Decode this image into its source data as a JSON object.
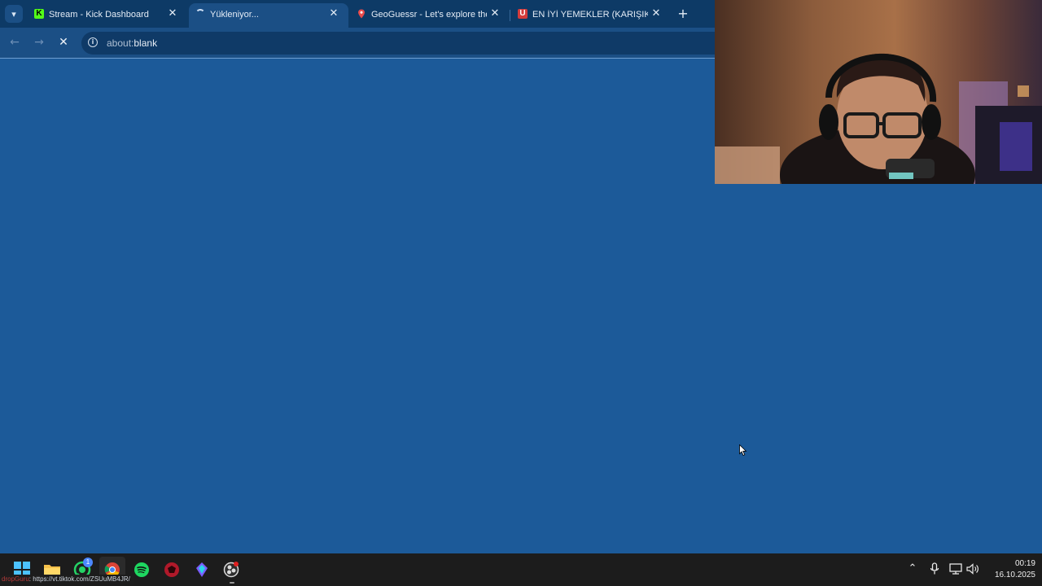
{
  "browser": {
    "tabs": [
      {
        "title": "Stream - Kick Dashboard",
        "favicon": "kick-icon",
        "active": false
      },
      {
        "title": "Yükleniyor...",
        "favicon": "loading-spinner-icon",
        "active": true
      },
      {
        "title": "GeoGuessr - Let's explore the w",
        "favicon": "map-pin-icon",
        "active": false
      },
      {
        "title": "EN İYİ YEMEKLER (KARIŞIK) @m",
        "favicon": "u-logo-icon",
        "active": false
      }
    ],
    "address_bar": {
      "url_scheme": "about:",
      "url_rest": "blank"
    },
    "theme": {
      "frame_color": "#0d3a66",
      "toolbar_color": "#1b4f85",
      "page_color": "#1c5a99"
    }
  },
  "taskbar": {
    "apps": [
      "windows-start-icon",
      "file-explorer-icon",
      "whatsapp-icon",
      "chrome-icon",
      "spotify-icon",
      "game-app-icon",
      "streaming-app-icon",
      "obs-icon"
    ],
    "whatsapp_badge": "1",
    "status_link": {
      "brand": "dropGuru",
      "url": ": https://vt.tiktok.com/ZSUuMB4JR/"
    },
    "clock": {
      "time": "00:19",
      "date": "16.10.2025"
    }
  }
}
